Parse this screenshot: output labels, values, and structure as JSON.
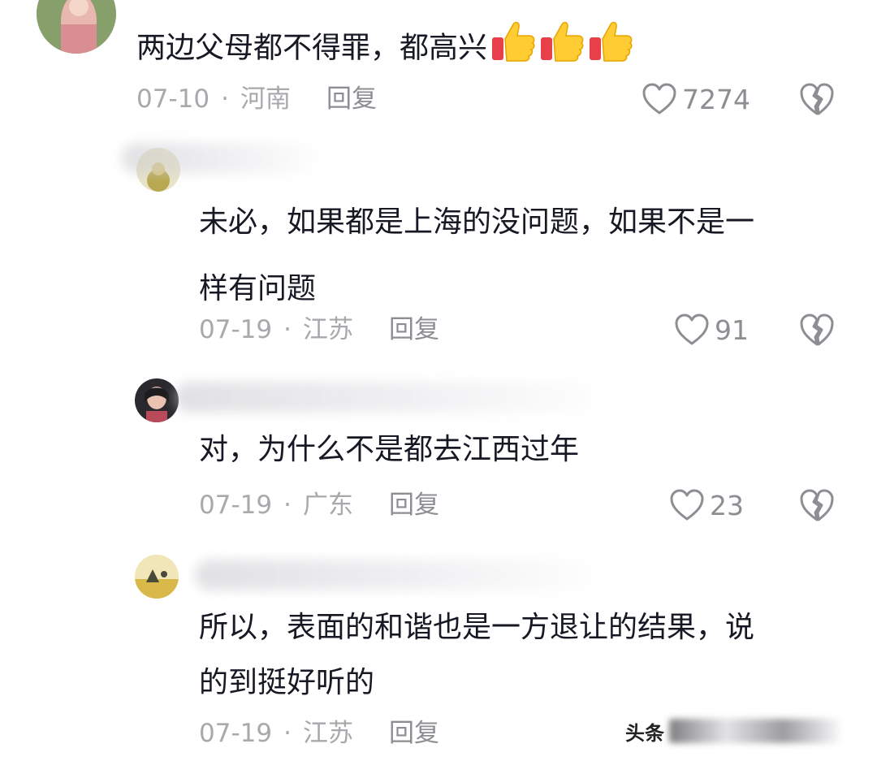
{
  "comments": [
    {
      "text_lines": [
        "两边父母都不得罪，都高兴"
      ],
      "emoji": "thumbs-up-icon",
      "emoji_count": 3,
      "date": "07-10",
      "location": "河南",
      "reply_label": "回复",
      "likes": "7274"
    },
    {
      "text_lines": [
        "未必，如果都是上海的没问题，如果不是一",
        "样有问题"
      ],
      "date": "07-19",
      "location": "江苏",
      "reply_label": "回复",
      "likes": "91"
    },
    {
      "text_lines": [
        "对，为什么不是都去江西过年"
      ],
      "date": "07-19",
      "location": "广东",
      "reply_label": "回复",
      "likes": "23"
    },
    {
      "text_lines": [
        "所以，表面的和谐也是一方退让的结果，说",
        "的到挺好听的"
      ],
      "date": "07-19",
      "location": "江苏",
      "reply_label": "回复"
    }
  ],
  "separator": "·",
  "watermark": {
    "text": "头条"
  },
  "colors": {
    "text": "#161823",
    "meta": "#a8a9ad",
    "icon": "#8d8e93"
  }
}
